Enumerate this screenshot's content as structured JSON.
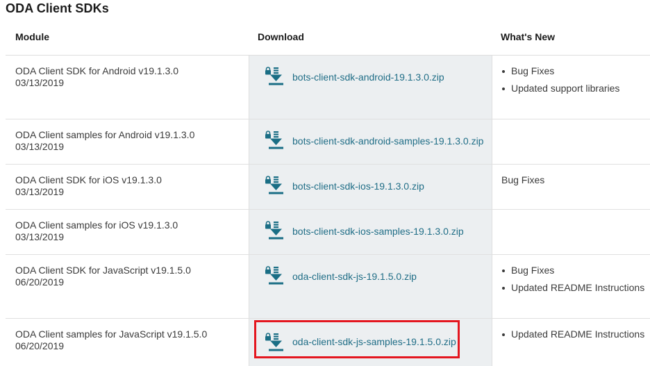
{
  "page": {
    "title": "ODA Client SDKs"
  },
  "table": {
    "headers": {
      "module": "Module",
      "download": "Download",
      "whats_new": "What's New"
    },
    "rows": [
      {
        "module": "ODA Client SDK for Android v19.1.3.0",
        "date": "03/13/2019",
        "file": "bots-client-sdk-android-19.1.3.0.zip",
        "whats_new": [
          "Bug Fixes",
          "Updated support libraries"
        ]
      },
      {
        "module": "ODA Client samples for Android v19.1.3.0",
        "date": "03/13/2019",
        "file": "bots-client-sdk-android-samples-19.1.3.0.zip",
        "whats_new": []
      },
      {
        "module": "ODA Client SDK for iOS v19.1.3.0",
        "date": "03/13/2019",
        "file": "bots-client-sdk-ios-19.1.3.0.zip",
        "whats_new_text": "Bug Fixes"
      },
      {
        "module": "ODA Client samples for iOS v19.1.3.0",
        "date": "03/13/2019",
        "file": "bots-client-sdk-ios-samples-19.1.3.0.zip",
        "whats_new": []
      },
      {
        "module": "ODA Client SDK for JavaScript v19.1.5.0",
        "date": "06/20/2019",
        "file": "oda-client-sdk-js-19.1.5.0.zip",
        "whats_new": [
          "Bug Fixes",
          "Updated README Instructions"
        ]
      },
      {
        "module": "ODA Client samples for JavaScript v19.1.5.0",
        "date": "06/20/2019",
        "file": "oda-client-sdk-js-samples-19.1.5.0.zip",
        "whats_new": [
          "Updated README Instructions"
        ]
      }
    ]
  },
  "icons": {
    "download": "lock-download-icon"
  },
  "colors": {
    "link": "#1f6d86",
    "icon": "#1a6e85",
    "download_cell_bg": "#eceff1",
    "highlight": "#e4161f"
  }
}
